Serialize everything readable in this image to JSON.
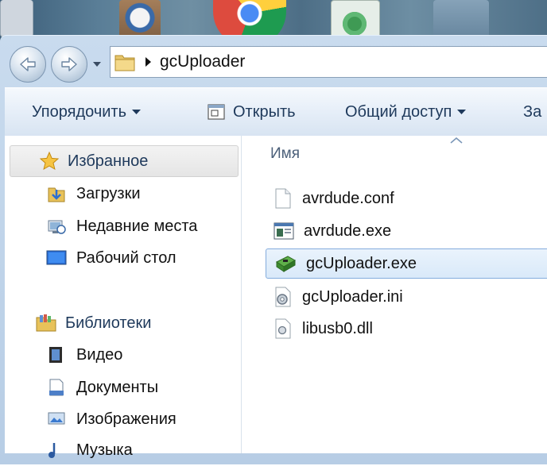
{
  "address_bar": {
    "path": "gcUploader"
  },
  "toolbar": {
    "organize_label": "Упорядочить",
    "open_label": "Открыть",
    "share_label": "Общий доступ",
    "more_label": "За"
  },
  "nav_pane": {
    "favorites": {
      "label": "Избранное",
      "items": [
        {
          "label": "Загрузки",
          "icon": "downloads-folder-icon"
        },
        {
          "label": "Недавние места",
          "icon": "recent-places-icon"
        },
        {
          "label": "Рабочий стол",
          "icon": "desktop-icon"
        }
      ]
    },
    "libraries": {
      "label": "Библиотеки",
      "items": [
        {
          "label": "Видео",
          "icon": "video-library-icon"
        },
        {
          "label": "Документы",
          "icon": "documents-library-icon"
        },
        {
          "label": "Изображения",
          "icon": "pictures-library-icon"
        },
        {
          "label": "Музыка",
          "icon": "music-library-icon"
        }
      ]
    }
  },
  "file_list": {
    "column_name": "Имя",
    "files": [
      {
        "name": "avrdude.conf",
        "icon": "text-file-icon",
        "selected": false
      },
      {
        "name": "avrdude.exe",
        "icon": "exe-window-icon",
        "selected": false
      },
      {
        "name": "gcUploader.exe",
        "icon": "green-board-exe-icon",
        "selected": true
      },
      {
        "name": "gcUploader.ini",
        "icon": "settings-file-icon",
        "selected": false
      },
      {
        "name": "libusb0.dll",
        "icon": "dll-file-icon",
        "selected": false
      }
    ]
  },
  "colors": {
    "toolbar_text": "#1e395b",
    "selection_border": "#84acdd",
    "selection_fill": "#d9e9f9"
  }
}
